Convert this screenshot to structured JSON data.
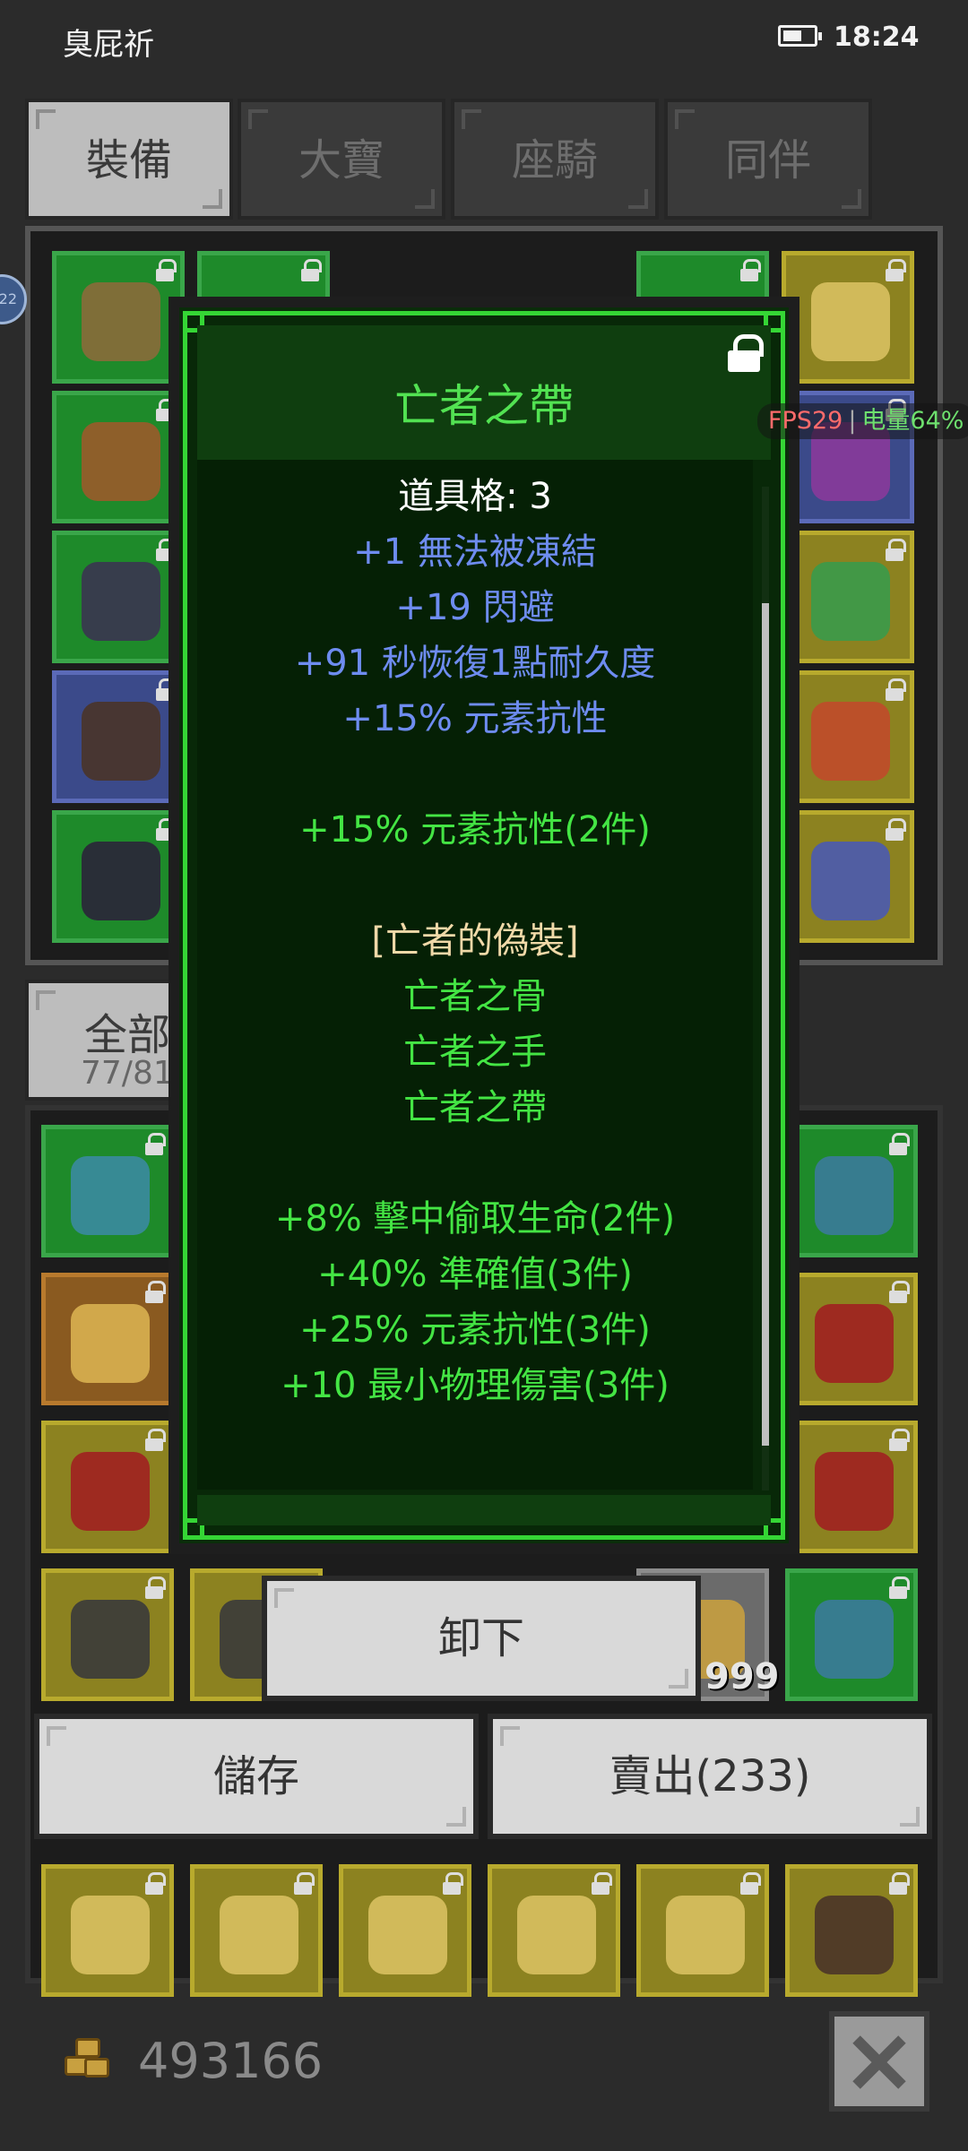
{
  "status_bar": {
    "app_name": "臭屁祈",
    "time": "18:24",
    "battery_percent": 64
  },
  "tabs": [
    {
      "label": "裝備",
      "active": true
    },
    {
      "label": "大寶",
      "active": false
    },
    {
      "label": "座騎",
      "active": false
    },
    {
      "label": "同伴",
      "active": false
    }
  ],
  "filter_tab": {
    "label": "全部",
    "count": "77/81"
  },
  "fps_overlay": {
    "fps": "FPS29",
    "battery": "电量64%"
  },
  "side_badge": "22",
  "tooltip": {
    "title": "亡者之帶",
    "lines": [
      {
        "text": "道具格: 3",
        "color": "white"
      },
      {
        "text": "+1 無法被凍結",
        "color": "blue"
      },
      {
        "text": "+19 閃避",
        "color": "blue"
      },
      {
        "text": "+91 秒恢復1點耐久度",
        "color": "blue"
      },
      {
        "text": "+15% 元素抗性",
        "color": "blue"
      },
      {
        "text": "",
        "color": "white"
      },
      {
        "text": "+15% 元素抗性(2件)",
        "color": "green"
      },
      {
        "text": "",
        "color": "white"
      },
      {
        "text": "[亡者的偽裝]",
        "color": "tan"
      },
      {
        "text": "亡者之骨",
        "color": "green"
      },
      {
        "text": "亡者之手",
        "color": "green"
      },
      {
        "text": "亡者之帶",
        "color": "green"
      },
      {
        "text": "",
        "color": "white"
      },
      {
        "text": "+8% 擊中偷取生命(2件)",
        "color": "green"
      },
      {
        "text": "+40% 準確值(3件)",
        "color": "green"
      },
      {
        "text": "+25% 元素抗性(3件)",
        "color": "green"
      },
      {
        "text": "+10 最小物理傷害(3件)",
        "color": "green"
      }
    ]
  },
  "buttons": {
    "unequip": "卸下",
    "store": "儲存",
    "sell": "賣出(233)"
  },
  "stack_count": "999",
  "gold": "493166",
  "colors": {
    "accent_green": "#35d635",
    "stat_blue": "#6e8cf0",
    "set_green": "#44e544",
    "set_name_tan": "#f0d9a8"
  }
}
